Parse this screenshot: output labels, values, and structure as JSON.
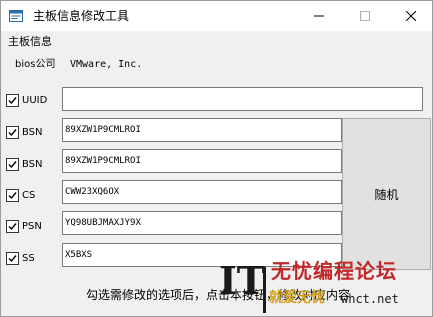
{
  "window": {
    "title": "主板信息修改工具",
    "title_icon": "app-window-icon",
    "controls": [
      "minimize-icon",
      "maximize-icon",
      "close-icon"
    ]
  },
  "group": {
    "label": "主板信息"
  },
  "bios": {
    "label": "bios公司",
    "value": "VMware, Inc."
  },
  "fields": [
    {
      "label": "UUID",
      "checked": true,
      "value": ""
    },
    {
      "label": "BSN",
      "checked": true,
      "value": "89XZW1P9CMLROI"
    },
    {
      "label": "BSN",
      "checked": true,
      "value": "89XZW1P9CMLROI"
    },
    {
      "label": "CS",
      "checked": true,
      "value": "CWW23XQ6OX"
    },
    {
      "label": "PSN",
      "checked": true,
      "value": "YQ98UBJMAXJY9X"
    },
    {
      "label": "SS",
      "checked": true,
      "value": "X5BXS"
    }
  ],
  "random_button": {
    "label": "随机"
  },
  "footer": {
    "hint": "勾选需修改的选项后，点击本按钮，修改对应内容"
  },
  "watermark": {
    "brand": "IT",
    "title": "无忧编程论坛",
    "subtitle": "就爱无忧",
    "url": "whct.net",
    "colors": {
      "title": "#c0282a",
      "subtitle": "#d4a017"
    }
  }
}
